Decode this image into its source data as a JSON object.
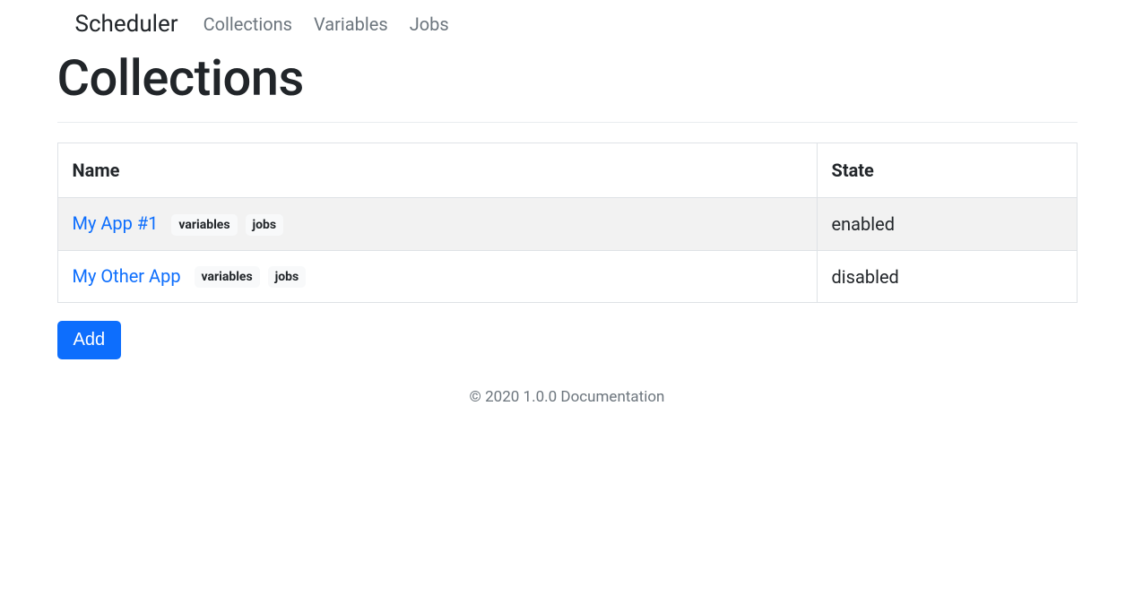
{
  "brand": "Scheduler",
  "nav": {
    "collections": "Collections",
    "variables": "Variables",
    "jobs": "Jobs"
  },
  "page_title": "Collections",
  "table": {
    "headers": {
      "name": "Name",
      "state": "State"
    },
    "rows": [
      {
        "name": "My App #1",
        "badges": {
          "variables": "variables",
          "jobs": "jobs"
        },
        "state": "enabled"
      },
      {
        "name": "My Other App",
        "badges": {
          "variables": "variables",
          "jobs": "jobs"
        },
        "state": "disabled"
      }
    ]
  },
  "add_button": "Add",
  "footer": {
    "copyright": "© 2020 1.0.0 ",
    "doc_link": "Documentation"
  }
}
